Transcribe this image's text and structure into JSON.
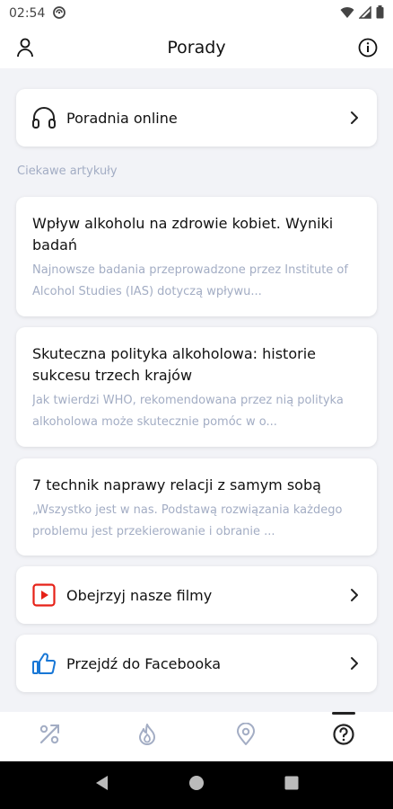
{
  "status_bar": {
    "time": "02:54"
  },
  "app_bar": {
    "title": "Porady",
    "left_icon": "user-icon",
    "right_icon": "info-icon"
  },
  "online_card": {
    "label": "Poradnia online",
    "icon": "headphones-icon"
  },
  "section_label": "Ciekawe artykuły",
  "articles": [
    {
      "title": "Wpływ alkoholu na zdrowie kobiet. Wyniki badań",
      "description": "Najnowsze badania przeprowadzone przez Institute of Alcohol Studies (IAS) dotyczą wpływu..."
    },
    {
      "title": "Skuteczna polityka alkoholowa: historie sukcesu trzech krajów",
      "description": "Jak twierdzi WHO, rekomendowana przez nią polityka alkoholowa może skutecznie pomóc w o..."
    },
    {
      "title": "7 technik naprawy relacji z samym sobą",
      "description": "„Wszystko jest w nas. Podstawą rozwiązania każdego problemu jest przekierowanie i obranie ..."
    }
  ],
  "video_card": {
    "label": "Obejrzyj nasze filmy",
    "icon": "youtube-icon",
    "icon_color": "#e62117"
  },
  "facebook_card": {
    "label": "Przejdź do Facebooka",
    "icon": "thumbs-up-icon",
    "icon_color": "#1877d6"
  },
  "bottom_nav": {
    "items": [
      {
        "icon": "percent-icon",
        "active": false
      },
      {
        "icon": "flame-icon",
        "active": false
      },
      {
        "icon": "location-pin-icon",
        "active": false
      },
      {
        "icon": "help-icon",
        "active": true
      }
    ],
    "inactive_color": "#a3adc4",
    "active_color": "#222222"
  }
}
